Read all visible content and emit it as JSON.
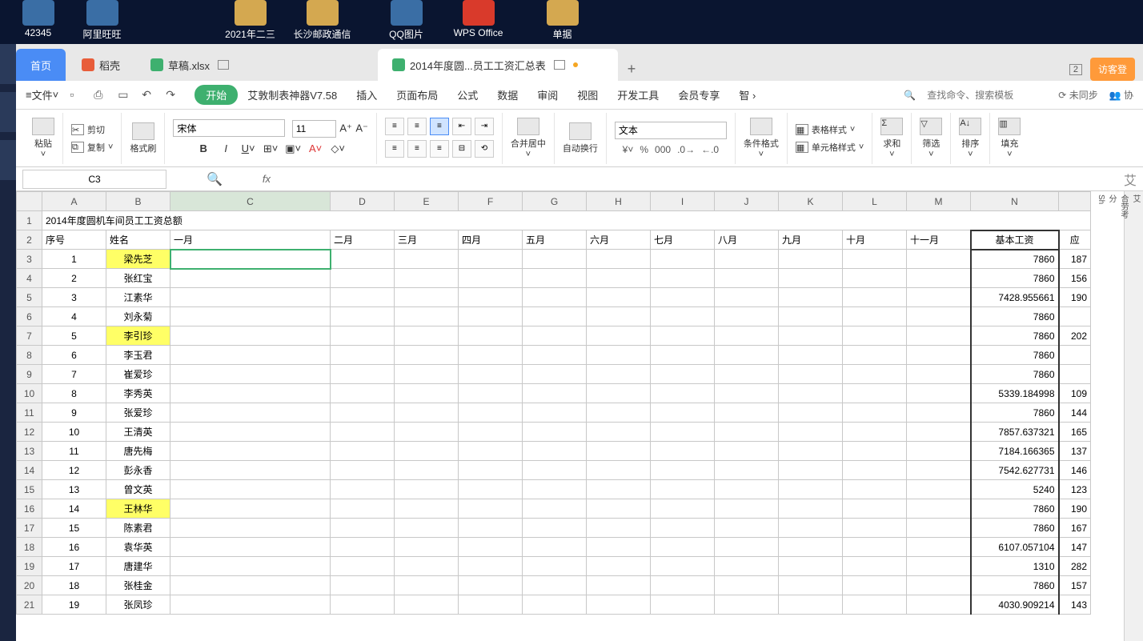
{
  "desktop": {
    "icons": [
      {
        "label": "42345"
      },
      {
        "label": "阿里旺旺"
      },
      {
        "label": "2021年二三"
      },
      {
        "label": "长沙邮政通信"
      },
      {
        "label": "QQ图片"
      },
      {
        "label": "WPS Office"
      },
      {
        "label": "单据"
      }
    ]
  },
  "tabs": {
    "home": "首页",
    "doco": "稻壳",
    "file1": "草稿.xlsx",
    "file2": "2014年度圆...员工工资汇总表",
    "badge": "2",
    "login": "访客登"
  },
  "menu": {
    "file": "文件",
    "items": [
      "开始",
      "艾敦制表神器V7.58",
      "插入",
      "页面布局",
      "公式",
      "数据",
      "审阅",
      "视图",
      "开发工具",
      "会员专享",
      "智"
    ],
    "search_placeholder": "查找命令、搜索模板",
    "sync": "未同步",
    "collab": "协"
  },
  "ribbon": {
    "paste": "粘贴",
    "cut": "剪切",
    "copy": "复制",
    "brush": "格式刷",
    "font": "宋体",
    "size": "11",
    "merge": "合并居中",
    "wrap": "自动换行",
    "numfmt": "文本",
    "cond": "条件格式",
    "tblstyle": "表格样式",
    "cellstyle": "单元格样式",
    "sum": "求和",
    "filter": "筛选",
    "sort": "排序",
    "fill": "填充"
  },
  "namebox": "C3",
  "sheet": {
    "cols": [
      "A",
      "B",
      "C",
      "D",
      "E",
      "F",
      "G",
      "H",
      "I",
      "J",
      "K",
      "L",
      "M",
      "N"
    ],
    "title": "2014年度圆机车间员工工资总额",
    "header_seq": "序号",
    "header_name": "姓名",
    "months": [
      "一月",
      "二月",
      "三月",
      "四月",
      "五月",
      "六月",
      "七月",
      "八月",
      "九月",
      "十月",
      "十一月"
    ],
    "base_salary_label": "基本工资",
    "ying_label": "应",
    "rows": [
      {
        "n": 1,
        "name": "梁先芝",
        "hl": true,
        "base": "7860",
        "o": "187"
      },
      {
        "n": 2,
        "name": "张红宝",
        "hl": false,
        "base": "7860",
        "o": "156"
      },
      {
        "n": 3,
        "name": "江素华",
        "hl": false,
        "base": "7428.955661",
        "o": "190"
      },
      {
        "n": 4,
        "name": "刘永菊",
        "hl": false,
        "base": "7860",
        "o": ""
      },
      {
        "n": 5,
        "name": "李引珍",
        "hl": true,
        "base": "7860",
        "o": "202"
      },
      {
        "n": 6,
        "name": "李玉君",
        "hl": false,
        "base": "7860",
        "o": ""
      },
      {
        "n": 7,
        "name": "崔爱珍",
        "hl": false,
        "base": "7860",
        "o": ""
      },
      {
        "n": 8,
        "name": "李秀英",
        "hl": false,
        "base": "5339.184998",
        "o": "109"
      },
      {
        "n": 9,
        "name": "张爱珍",
        "hl": false,
        "base": "7860",
        "o": "144"
      },
      {
        "n": 10,
        "name": "王清英",
        "hl": false,
        "base": "7857.637321",
        "o": "165"
      },
      {
        "n": 11,
        "name": "唐先梅",
        "hl": false,
        "base": "7184.166365",
        "o": "137"
      },
      {
        "n": 12,
        "name": "彭永香",
        "hl": false,
        "base": "7542.627731",
        "o": "146"
      },
      {
        "n": 13,
        "name": "曾文英",
        "hl": false,
        "base": "5240",
        "o": "123"
      },
      {
        "n": 14,
        "name": "王林华",
        "hl": true,
        "base": "7860",
        "o": "190"
      },
      {
        "n": 15,
        "name": "陈素君",
        "hl": false,
        "base": "7860",
        "o": "167"
      },
      {
        "n": 16,
        "name": "袁华英",
        "hl": false,
        "base": "6107.057104",
        "o": "147"
      },
      {
        "n": 17,
        "name": "唐建华",
        "hl": false,
        "base": "1310",
        "o": "282"
      },
      {
        "n": 18,
        "name": "张桂金",
        "hl": false,
        "base": "7860",
        "o": "157"
      },
      {
        "n": 19,
        "name": "张凤珍",
        "hl": false,
        "base": "4030.909214",
        "o": "143"
      }
    ]
  },
  "rightpanel": [
    "艾",
    "合劳考",
    "分",
    "Sh"
  ]
}
